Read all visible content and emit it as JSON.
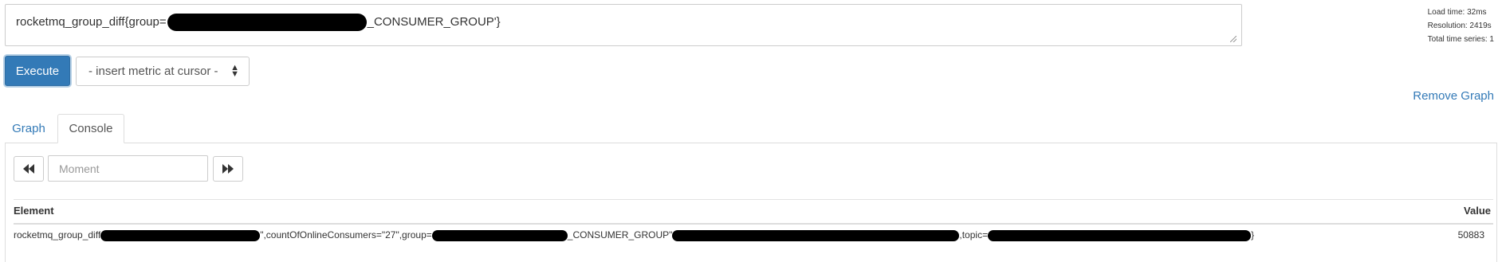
{
  "expression": {
    "prefix": "rocketmq_group_diff{group=",
    "suffix": "_CONSUMER_GROUP'}"
  },
  "stats": {
    "load_time": "Load time: 32ms",
    "resolution": "Resolution: 2419s",
    "total_series": "Total time series: 1"
  },
  "toolbar": {
    "execute_label": "Execute",
    "metric_select_value": "- insert metric at cursor -"
  },
  "remove_graph_label": "Remove Graph",
  "tabs": [
    {
      "label": "Graph",
      "active": false
    },
    {
      "label": "Console",
      "active": true
    }
  ],
  "moment": {
    "placeholder": "Moment"
  },
  "table": {
    "columns": [
      "Element",
      "Value"
    ],
    "rows": [
      {
        "element_part1": "rocketmq_group_diff",
        "element_part2": "\",countOfOnlineConsumers=\"27\",group=",
        "element_part3": "_CONSUMER_GROUP\"",
        "element_part4": ",topic=",
        "element_part5": "}",
        "value": "50883"
      }
    ]
  }
}
